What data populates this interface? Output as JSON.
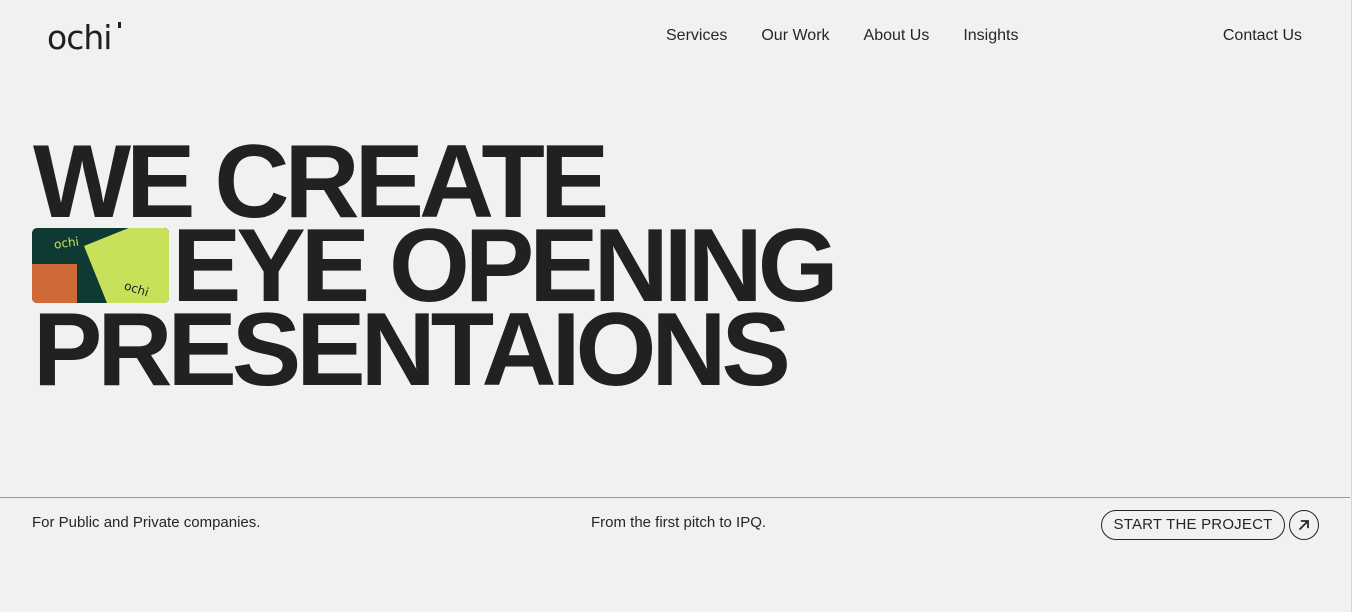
{
  "header": {
    "logo": "ochi",
    "nav": [
      "Services",
      "Our Work",
      "About Us",
      "Insights"
    ],
    "contact": "Contact Us"
  },
  "hero": {
    "line1": "WE CREATE",
    "line2": "EYE OPENING",
    "line3": "PRESENTAIONS",
    "thumbnail_logo_text": "ochi",
    "thumbnail_colors": {
      "dark_green": "#0f3a34",
      "lime": "#c7e25a",
      "orange": "#cf6a38",
      "dark": "#1d1d1d"
    }
  },
  "footer_strip": {
    "left": "For Public and Private companies.",
    "middle": "From the first pitch to IPQ.",
    "cta_label": "START THE PROJECT",
    "cta_icon": "arrow-up-right-icon"
  },
  "colors": {
    "background": "#f1f1f1",
    "text": "#212121"
  }
}
